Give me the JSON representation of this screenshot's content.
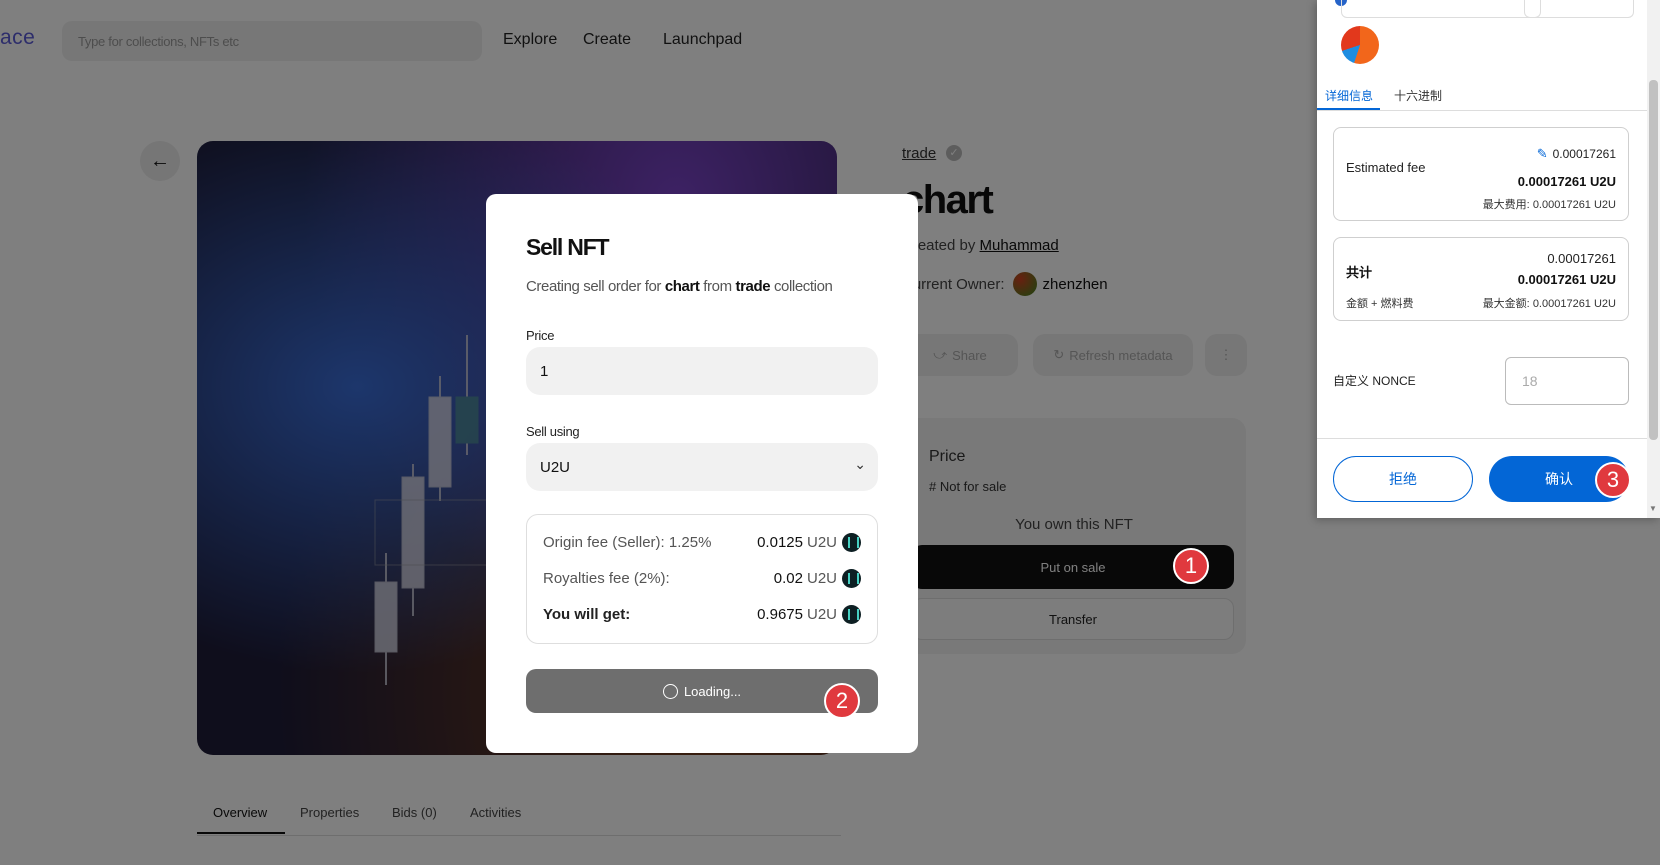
{
  "header": {
    "logo_fragment": "ace",
    "search_placeholder": "Type for collections, NFTs etc",
    "nav": [
      "Explore",
      "Create",
      "Launchpad"
    ]
  },
  "nft": {
    "collection": "trade",
    "title": "chart",
    "created_by_label": "Created by",
    "creator": "Muhammad",
    "owner_label": "Current Owner:",
    "owner": "zhenzhen",
    "share_label": "Share",
    "refresh_label": "Refresh metadata",
    "more_label": "⋮",
    "price_label": "Price",
    "sale_status": "# Not for sale",
    "own_text": "You own this NFT",
    "put_on_sale": "Put on sale",
    "transfer": "Transfer",
    "tabs": [
      "Overview",
      "Properties",
      "Bids (0)",
      "Activities"
    ]
  },
  "modal": {
    "title": "Sell NFT",
    "subtitle_pre": "Creating sell order for",
    "subtitle_nft": "chart",
    "subtitle_mid": "from",
    "subtitle_collection": "trade",
    "subtitle_post": "collection",
    "price_label": "Price",
    "price_value": "1",
    "sell_using_label": "Sell using",
    "sell_using_value": "U2U",
    "fees": [
      {
        "label": "Origin fee (Seller): 1.25%",
        "amount": "0.0125",
        "unit": "U2U"
      },
      {
        "label": "Royalties fee (2%):",
        "amount": "0.02",
        "unit": "U2U"
      },
      {
        "label": "You will get:",
        "amount": "0.9675",
        "unit": "U2U"
      }
    ],
    "loading_label": "Loading..."
  },
  "badges": [
    "1",
    "2",
    "3"
  ],
  "wallet": {
    "tabs": [
      "详细信息",
      "十六进制"
    ],
    "estimated_fee_label": "Estimated fee",
    "estimated_fee_edit": "0.00017261",
    "estimated_fee_main": "0.00017261 U2U",
    "max_fee_label": "最大费用:",
    "max_fee_value": "0.00017261 U2U",
    "total_label": "共计",
    "total_top": "0.00017261",
    "total_main": "0.00017261 U2U",
    "total_sub_label": "金额 + 燃料费",
    "max_amount_label": "最大金额:",
    "max_amount_value": "0.00017261 U2U",
    "nonce_label": "自定义 NONCE",
    "nonce_value": "18",
    "reject": "拒绝",
    "confirm": "确认"
  },
  "colors": {
    "accent": "#0366d6",
    "badge": "#e0393e",
    "coin": "#0d1f23"
  }
}
